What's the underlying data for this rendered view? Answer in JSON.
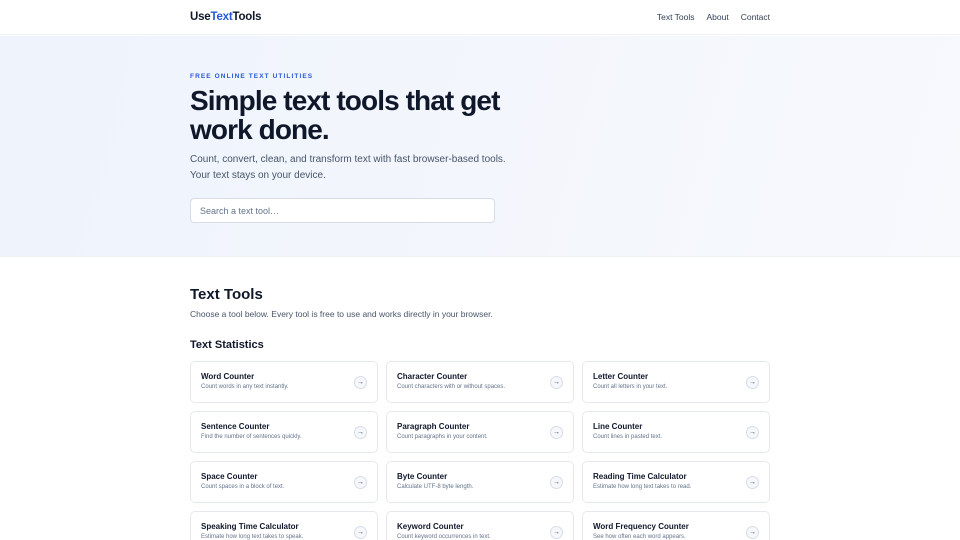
{
  "header": {
    "logo_prefix": "Use",
    "logo_accent": "Text",
    "logo_suffix": "Tools",
    "nav": [
      "Text Tools",
      "About",
      "Contact"
    ]
  },
  "hero": {
    "eyebrow": "FREE ONLINE TEXT UTILITIES",
    "title": "Simple text tools that get work done.",
    "subtitle": "Count, convert, clean, and transform text with fast browser-based tools. Your text stays on your device.",
    "search_placeholder": "Search a text tool…"
  },
  "main": {
    "title": "Text Tools",
    "description": "Choose a tool below. Every tool is free to use and works directly in your browser.",
    "group_title": "Text Statistics",
    "tools": [
      {
        "name": "Word Counter",
        "desc": "Count words in any text instantly."
      },
      {
        "name": "Character Counter",
        "desc": "Count characters with or without spaces."
      },
      {
        "name": "Letter Counter",
        "desc": "Count all letters in your text."
      },
      {
        "name": "Sentence Counter",
        "desc": "Find the number of sentences quickly."
      },
      {
        "name": "Paragraph Counter",
        "desc": "Count paragraphs in your content."
      },
      {
        "name": "Line Counter",
        "desc": "Count lines in pasted text."
      },
      {
        "name": "Space Counter",
        "desc": "Count spaces in a block of text."
      },
      {
        "name": "Byte Counter",
        "desc": "Calculate UTF-8 byte length."
      },
      {
        "name": "Reading Time Calculator",
        "desc": "Estimate how long text takes to read."
      },
      {
        "name": "Speaking Time Calculator",
        "desc": "Estimate how long text takes to speak."
      },
      {
        "name": "Keyword Counter",
        "desc": "Count keyword occurrences in text."
      },
      {
        "name": "Word Frequency Counter",
        "desc": "See how often each word appears."
      }
    ],
    "arrow": "→"
  },
  "colors": {
    "accent": "#2557d6",
    "heading": "#0f172a",
    "muted": "#64748b"
  },
  "icons": {
    "card_action": "arrow-right-icon"
  }
}
